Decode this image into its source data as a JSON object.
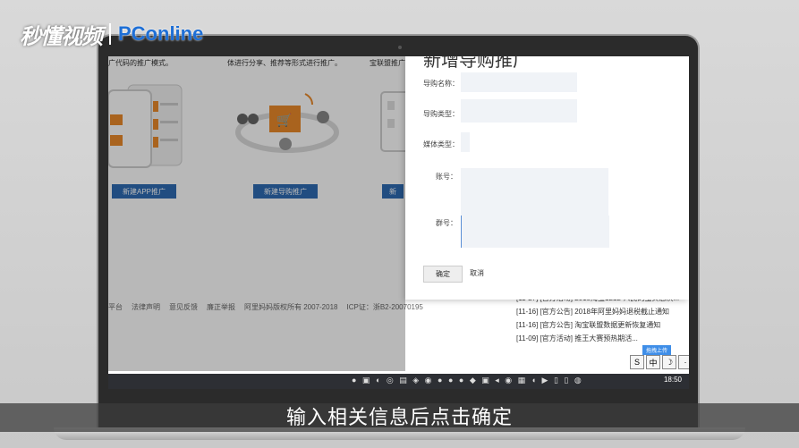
{
  "watermark": {
    "cn": "秒懂视频",
    "en": "PConline"
  },
  "page": {
    "top_texts": [
      "广代码的推广模式。",
      "体进行分享、推荐等形式进行推广。",
      "宝联盟推广"
    ],
    "buttons": [
      "新建APP推广",
      "新建导购推广",
      "新"
    ],
    "footer": [
      "平台",
      "法律声明",
      "意见反馈",
      "廉正举报",
      "阿里妈妈版权所有 2007-2018",
      "ICP证：浙B2-20070195"
    ]
  },
  "modal": {
    "title": "新增导购推广",
    "fields": [
      "导购名称：",
      "导购类型：",
      "媒体类型：",
      "账号：",
      "群号："
    ],
    "ok_label": "确定",
    "cancel_label": "取消"
  },
  "news": [
    "[11-27]  [官方活动] 2018淘宝1212-人民的宝贝总决...",
    "[11-16]  [官方公告] 2018年阿里妈妈退税截止通知",
    "[11-16]  [官方公告] 淘宝联盟数据更新恢复通知",
    "[11-09]  [官方活动] 推王大赛预热期活..."
  ],
  "ime": {
    "tip": "拖拽上传",
    "keys": [
      "S",
      "中",
      "☽",
      "·"
    ]
  },
  "taskbar": {
    "time": "18:50"
  },
  "subtitle": "输入相关信息后点击确定",
  "colors": {
    "primary_button": "#2f6bb3",
    "accent_orange": "#ea8a2a"
  }
}
